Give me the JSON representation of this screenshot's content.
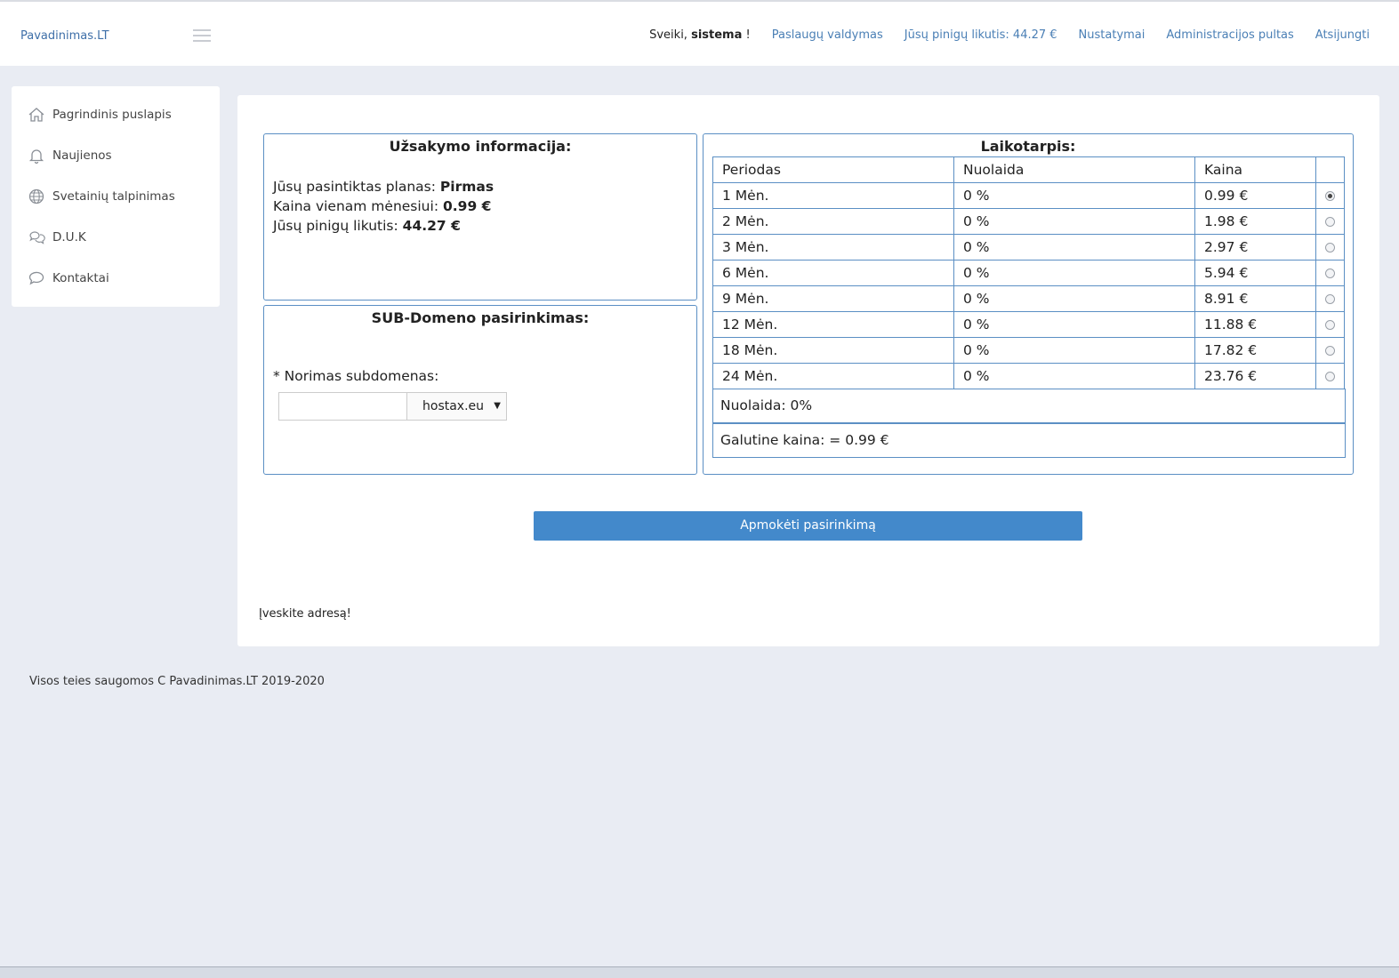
{
  "header": {
    "brand": "Pavadinimas.LT",
    "greeting_prefix": "Sveiki,",
    "user": "sistema",
    "greeting_suffix": "!",
    "nav": [
      "Paslaugų valdymas",
      "Jūsų pinigų likutis: 44.27 €",
      "Nustatymai",
      "Administracijos pultas",
      "Atsijungti"
    ]
  },
  "sidebar": {
    "items": [
      {
        "label": "Pagrindinis puslapis",
        "icon": "home-icon"
      },
      {
        "label": "Naujienos",
        "icon": "bell-icon"
      },
      {
        "label": "Svetainių talpinimas",
        "icon": "globe-icon"
      },
      {
        "label": "D.U.K",
        "icon": "chat-bubbles-icon"
      },
      {
        "label": "Kontaktai",
        "icon": "speech-bubble-icon"
      }
    ]
  },
  "order_info": {
    "title": "Užsakymo informacija:",
    "plan_label": "Jūsų pasintiktas planas:",
    "plan_value": "Pirmas",
    "price_label": "Kaina vienam mėnesiui:",
    "price_value": "0.99 €",
    "balance_label": "Jūsų pinigų likutis:",
    "balance_value": "44.27 €"
  },
  "subdomain": {
    "title": "SUB-Domeno pasirinkimas:",
    "label": "* Norimas subdomenas:",
    "input_value": "",
    "select_value": "hostax.eu"
  },
  "period": {
    "title": "Laikotarpis:",
    "headers": [
      "Periodas",
      "Nuolaida",
      "Kaina"
    ],
    "rows": [
      {
        "period": "1 Mėn.",
        "discount": "0 %",
        "price": "0.99 €",
        "selected": true
      },
      {
        "period": "2 Mėn.",
        "discount": "0 %",
        "price": "1.98 €",
        "selected": false
      },
      {
        "period": "3 Mėn.",
        "discount": "0 %",
        "price": "2.97 €",
        "selected": false
      },
      {
        "period": "6 Mėn.",
        "discount": "0 %",
        "price": "5.94 €",
        "selected": false
      },
      {
        "period": "9 Mėn.",
        "discount": "0 %",
        "price": "8.91 €",
        "selected": false
      },
      {
        "period": "12 Mėn.",
        "discount": "0 %",
        "price": "11.88 €",
        "selected": false
      },
      {
        "period": "18 Mėn.",
        "discount": "0 %",
        "price": "17.82 €",
        "selected": false
      },
      {
        "period": "24 Mėn.",
        "discount": "0 %",
        "price": "23.76 €",
        "selected": false
      }
    ],
    "discount_summary": "Nuolaida: 0%",
    "final_price": "Galutine kaina: = 0.99 €"
  },
  "pay_button": "Apmokėti pasirinkimą",
  "hint": "Įveskite adresą!",
  "footer": "Visos teies saugomos C Pavadinimas.LT 2019-2020"
}
